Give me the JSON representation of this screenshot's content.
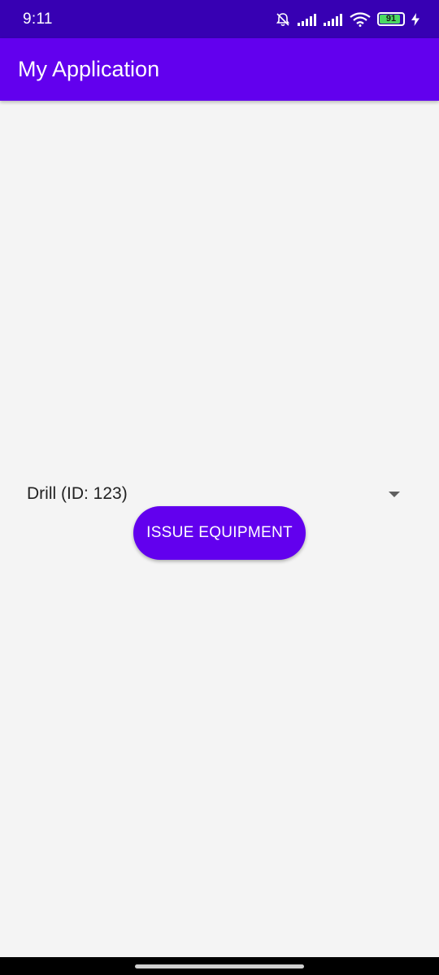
{
  "status_bar": {
    "time": "9:11",
    "battery_level": "91",
    "battery_fraction": 0.91,
    "icons": [
      "bell-off-icon",
      "signal-icon",
      "signal-icon",
      "wifi-icon",
      "battery-icon",
      "charging-icon"
    ]
  },
  "app_bar": {
    "title": "My Application"
  },
  "main": {
    "spinner_value": "Drill (ID: 123)",
    "issue_button_label": "ISSUE EQUIPMENT"
  },
  "colors": {
    "status_bar": "#3700b3",
    "primary": "#6200ee",
    "background": "#f4f4f4",
    "battery": "#4cd964"
  }
}
